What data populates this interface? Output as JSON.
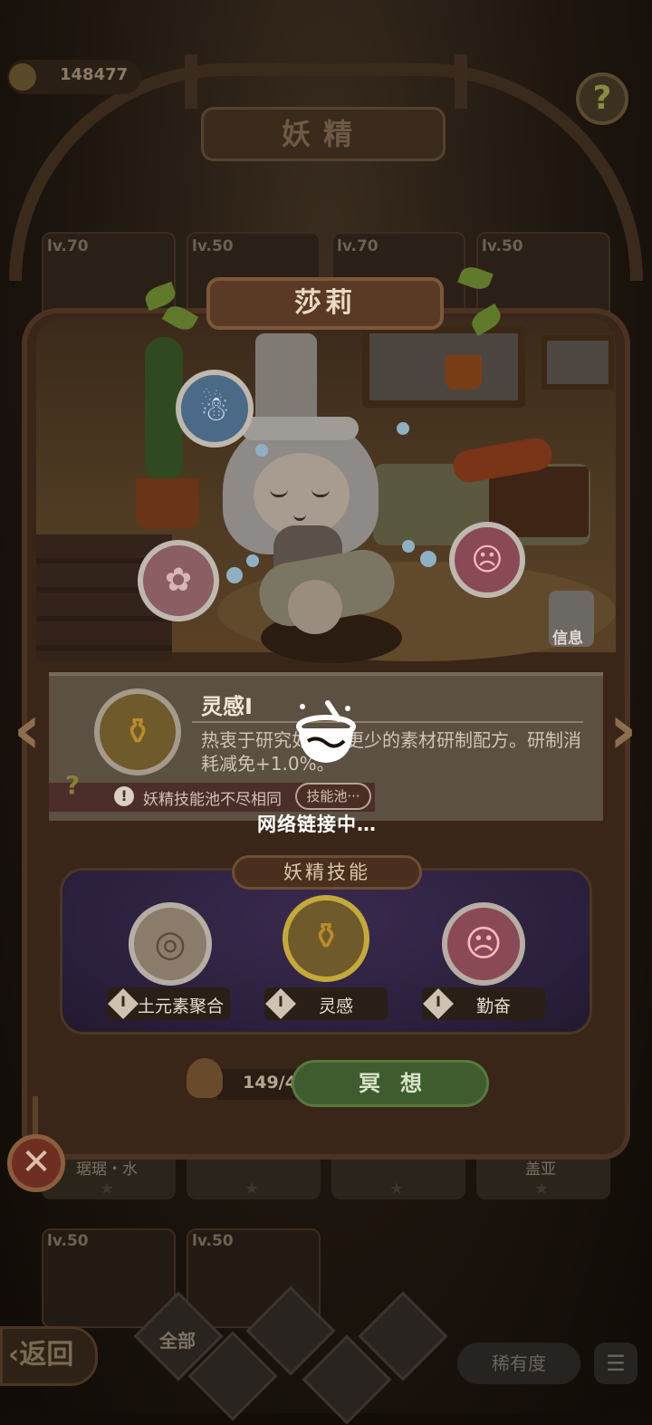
{
  "header": {
    "coins": "148477",
    "title": "妖精"
  },
  "background_cards": [
    {
      "level": "lv.70"
    },
    {
      "level": "lv.50"
    },
    {
      "level": "lv.70"
    },
    {
      "level": "lv.50"
    }
  ],
  "background_names": [
    "琚琚・水",
    "",
    "",
    "盖亚"
  ],
  "background_row2": [
    {
      "level": "lv.50"
    },
    {
      "level": "lv.50"
    }
  ],
  "bottom_bar": {
    "back_label": "返回",
    "all_label": "全部",
    "rarity_label": "稀有度"
  },
  "fairy": {
    "name": "莎莉"
  },
  "info_button": "信息",
  "skill_detail": {
    "title": "灵感I",
    "description": "热衷于研究如何用更少的素材研制配方。研制消耗减免+1.0%。",
    "warning": "妖精技能池不尽相同",
    "pool_button": "技能池···"
  },
  "skills_section": {
    "banner": "妖精技能",
    "skills": [
      {
        "level": "I",
        "name": "土元素聚合",
        "icon": "earth-swirl-icon"
      },
      {
        "level": "I",
        "name": "灵感",
        "icon": "golden-pot-icon"
      },
      {
        "level": "I",
        "name": "勤奋",
        "icon": "angry-face-icon"
      }
    ]
  },
  "meditate": {
    "cost": "149/4",
    "button": "冥想"
  },
  "loading": {
    "text": "网络链接中…",
    "icon": "cooking-pot-icon"
  },
  "colors": {
    "accent_green": "#3f5c2e",
    "overlay_dim": "#120d09"
  }
}
